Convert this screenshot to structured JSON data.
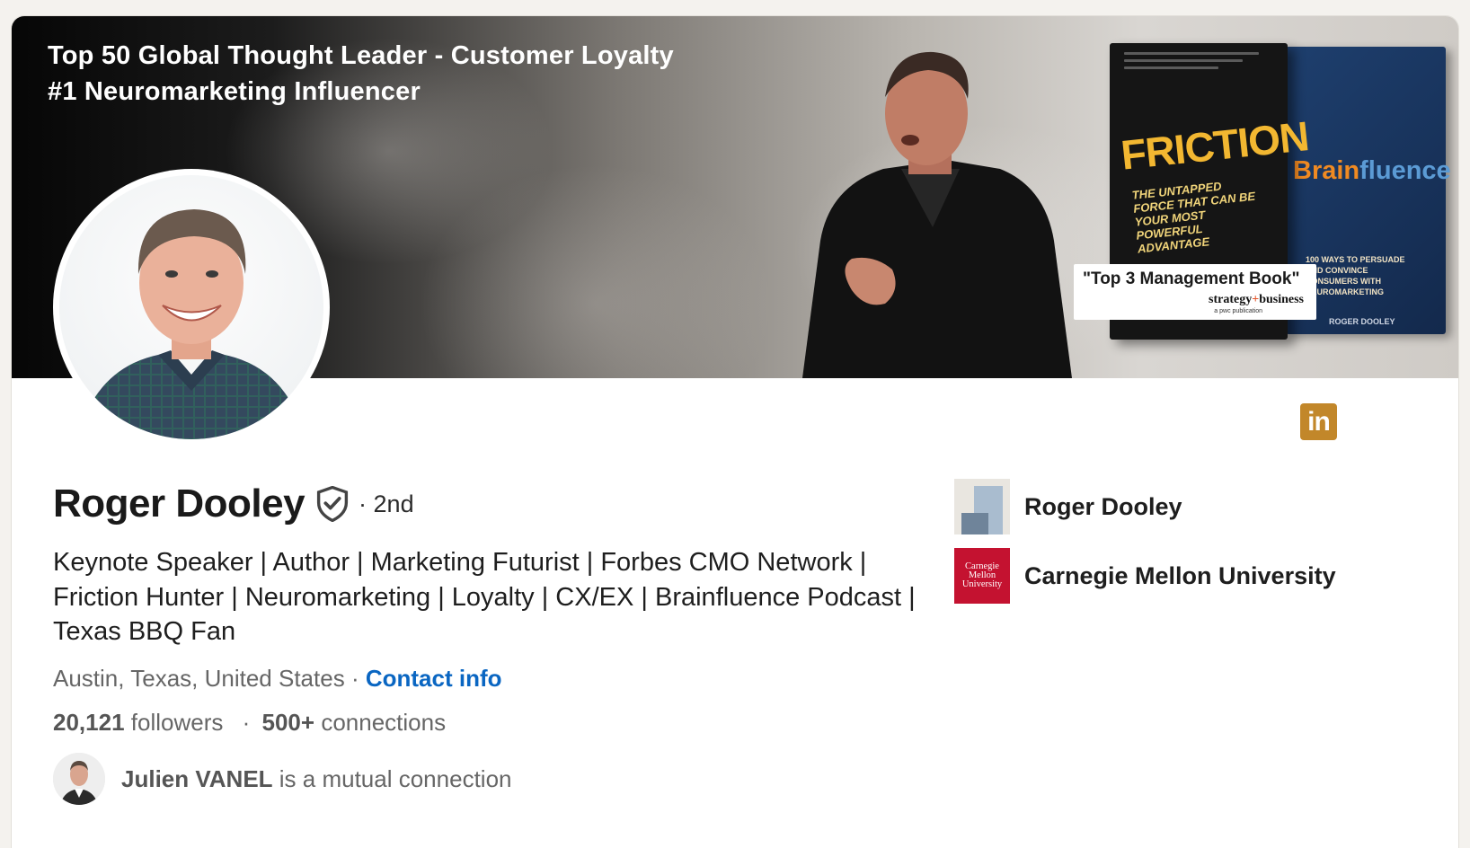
{
  "banner": {
    "line1": "Top 50 Global Thought Leader - Customer Loyalty",
    "line2": "#1 Neuromarketing Influencer",
    "book_front": {
      "title": "FRICTION",
      "subtitle": "THE UNTAPPED FORCE THAT CAN BE YOUR MOST POWERFUL ADVANTAGE"
    },
    "book_back": {
      "title_part1": "Brain",
      "title_part2": "fluence",
      "subtitle": "100 WAYS TO PERSUADE AND CONVINCE CONSUMERS WITH NEUROMARKETING",
      "author": "ROGER DOOLEY"
    },
    "award": {
      "quote": "\"Top 3 Management Book\"",
      "brand_left": "strategy",
      "brand_plus": "+",
      "brand_right": "business",
      "publication": "a pwc publication"
    }
  },
  "profile": {
    "name": "Roger Dooley",
    "degree": "· 2nd",
    "headline": "Keynote Speaker | Author | Marketing Futurist | Forbes CMO Network | Friction Hunter | Neuromarketing | Loyalty | CX/EX | Brainfluence Podcast | Texas BBQ Fan",
    "location": "Austin, Texas, United States",
    "separator": "·",
    "contact_info": "Contact info",
    "followers_count": "20,121",
    "followers_label": "followers",
    "connections_count": "500+",
    "connections_label": "connections",
    "mutual_name": "Julien VANEL",
    "mutual_suffix": "is a mutual connection"
  },
  "badge": {
    "label": "in",
    "icon": "linkedin-icon",
    "color": "#c2872a"
  },
  "sidebar": {
    "orgs": [
      {
        "name": "Roger Dooley",
        "logo": "generic-company-icon"
      },
      {
        "name": "Carnegie Mellon University",
        "logo": "cmu-logo",
        "logo_text_1": "Carnegie",
        "logo_text_2": "Mellon",
        "logo_text_3": "University",
        "color": "#c41230"
      }
    ]
  },
  "colors": {
    "link": "#0a66c2",
    "muted": "#666666",
    "text": "#1e1e1e"
  }
}
